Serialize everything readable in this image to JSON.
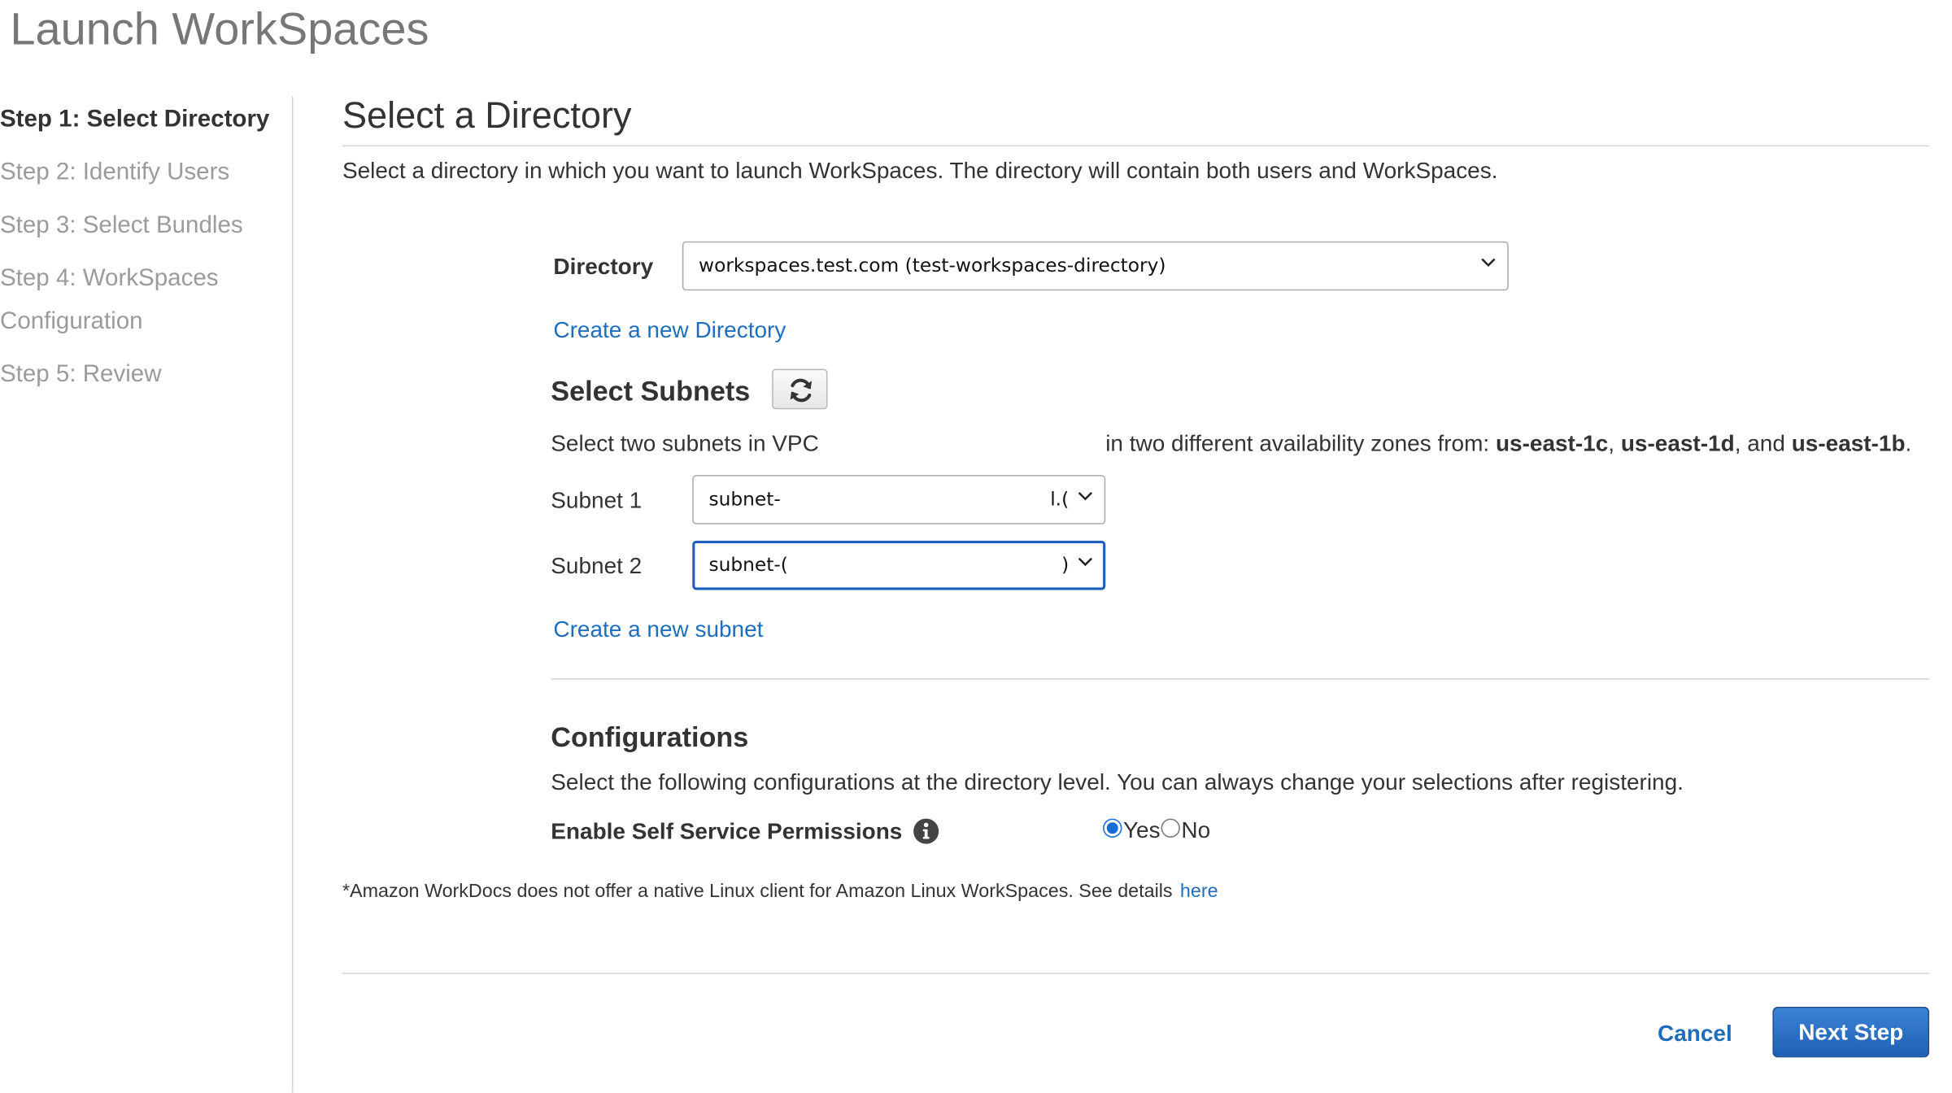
{
  "page": {
    "title": "Launch WorkSpaces"
  },
  "steps": [
    {
      "label": "Step 1: Select Directory",
      "active": true
    },
    {
      "label": "Step 2: Identify Users"
    },
    {
      "label": "Step 3: Select Bundles"
    },
    {
      "label_line1": "Step 4: WorkSpaces",
      "label_line2": "Configuration"
    },
    {
      "label": "Step 5: Review"
    }
  ],
  "main": {
    "title": "Select a Directory",
    "description": "Select a directory in which you want to launch WorkSpaces. The directory will contain both users and WorkSpaces.",
    "directory": {
      "label": "Directory",
      "value": "workspaces.test.com (test-workspaces-directory)",
      "create_link": "Create a new Directory"
    },
    "subnets": {
      "heading": "Select Subnets",
      "refresh_icon": "refresh-icon",
      "vpc_text_before": "Select two subnets in VPC",
      "vpc_text_after": "in two different availability zones from:",
      "zone1": "us-east-1c",
      "zone2": "us-east-1d",
      "zone_and": ", and",
      "zone3": "us-east-1b",
      "period": ".",
      "subnet1": {
        "label": "Subnet 1",
        "value": "subnet-",
        "tail": "l.("
      },
      "subnet2": {
        "label": "Subnet 2",
        "value": "subnet-(",
        "tail": ")"
      },
      "create_link": "Create a new subnet"
    },
    "configurations": {
      "heading": "Configurations",
      "description": "Select the following configurations at the directory level. You can always change your selections after registering.",
      "self_service": {
        "label": "Enable Self Service Permissions",
        "info_icon": "info-icon",
        "options": [
          "Yes",
          "No"
        ],
        "selected": "Yes"
      }
    },
    "footnote": {
      "text": "*Amazon WorkDocs does not offer a native Linux client for Amazon Linux WorkSpaces. See details",
      "link": "here"
    },
    "actions": {
      "cancel": "Cancel",
      "next": "Next Step"
    }
  },
  "colors": {
    "link": "#1f6dbd",
    "primary_button": "#2a6fc4",
    "focus_border": "#1a5fbf"
  }
}
